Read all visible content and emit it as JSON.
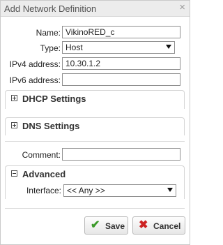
{
  "dialog": {
    "title": "Add Network Definition",
    "close_glyph": "×"
  },
  "form": {
    "name": {
      "label": "Name:",
      "value": "VikinoRED_c"
    },
    "type": {
      "label": "Type:",
      "value": "Host"
    },
    "ipv4": {
      "label": "IPv4 address:",
      "value": "10.30.1.2"
    },
    "ipv6": {
      "label": "IPv6 address:",
      "value": ""
    },
    "comment": {
      "label": "Comment:",
      "value": ""
    }
  },
  "sections": {
    "dhcp": {
      "title": "DHCP Settings",
      "expanded": false
    },
    "dns": {
      "title": "DNS Settings",
      "expanded": false
    },
    "advanced": {
      "title": "Advanced",
      "expanded": true,
      "interface": {
        "label": "Interface:",
        "value": "<< Any >>"
      }
    }
  },
  "buttons": {
    "save": {
      "label": "Save",
      "icon": "check-icon",
      "icon_color": "#3c9a2a"
    },
    "cancel": {
      "label": "Cancel",
      "icon": "x-icon",
      "icon_color": "#cc2222"
    }
  }
}
